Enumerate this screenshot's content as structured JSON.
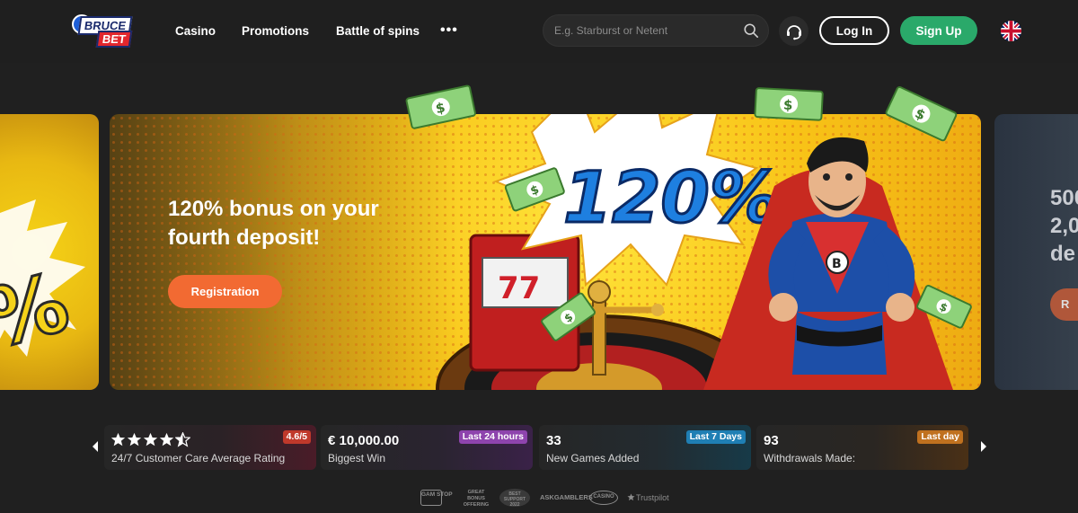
{
  "header": {
    "logo_top": "BRUCE",
    "logo_bottom": "BET",
    "nav": [
      "Casino",
      "Promotions",
      "Battle of spins"
    ],
    "more": "•••",
    "search_placeholder": "E.g. Starburst or Netent",
    "login_label": "Log In",
    "signup_label": "Sign Up"
  },
  "hero": {
    "title": "120% bonus on your fourth deposit!",
    "art_text": "120%",
    "slot_digits": "77",
    "cta_label": "Registration",
    "next_peek_lines": [
      "500",
      "2,0",
      "de"
    ],
    "next_peek_btn": "R"
  },
  "stats": [
    {
      "value": "",
      "label": "24/7 Customer Care Average Rating",
      "tag": "4.6/5",
      "tag_color": "#c0392b",
      "rating": 4.6
    },
    {
      "value": "€ 10,000.00",
      "label": "Biggest Win",
      "tag": "Last 24 hours",
      "tag_color": "#8e44ad"
    },
    {
      "value": "33",
      "label": "New Games Added",
      "tag": "Last 7 Days",
      "tag_color": "#1f7fb4"
    },
    {
      "value": "93",
      "label": "Withdrawals Made:",
      "tag": "Last day",
      "tag_color": "#c0711f"
    }
  ],
  "footer_badges": [
    "GAM STOP",
    "GREAT BONUS OFFERING",
    "BEST SUPPORT 2022",
    "ASKGAMBLERS",
    "CASINO",
    "Trustpilot"
  ],
  "colors": {
    "background": "#202020",
    "signup": "#2aa96a",
    "registration": "#f26a32",
    "banner_yellow": "#f8c317"
  }
}
